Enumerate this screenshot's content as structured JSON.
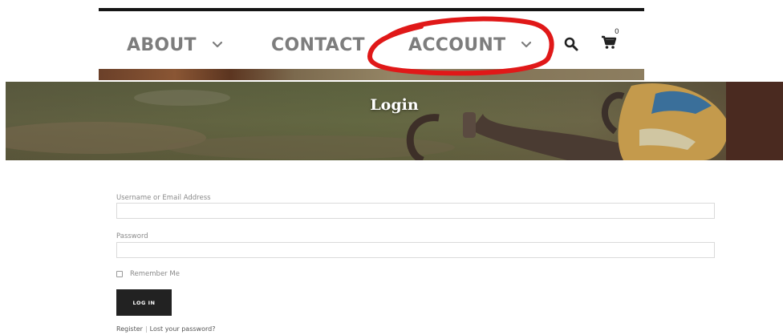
{
  "nav": {
    "items": [
      {
        "label": "ABOUT"
      },
      {
        "label": "CONTACT"
      },
      {
        "label": "ACCOUNT"
      }
    ],
    "cart_count": "0",
    "icons": [
      "chevron-down-icon",
      "search-icon",
      "cart-icon"
    ],
    "annotation_color": "#e01818"
  },
  "hero": {
    "title": "Login"
  },
  "form": {
    "username_label": "Username or Email Address",
    "username_value": "",
    "password_label": "Password",
    "password_value": "",
    "remember_label": "Remember Me",
    "remember_checked": false,
    "submit_label": "LOG IN"
  },
  "links": {
    "register": "Register",
    "separator": "|",
    "lost_password": "Lost your password?"
  },
  "colors": {
    "nav_text": "#7d7d7d",
    "button_bg": "#222222",
    "button_text": "#ffffff",
    "label_text": "#8a8a8a",
    "input_border": "#dadada"
  }
}
